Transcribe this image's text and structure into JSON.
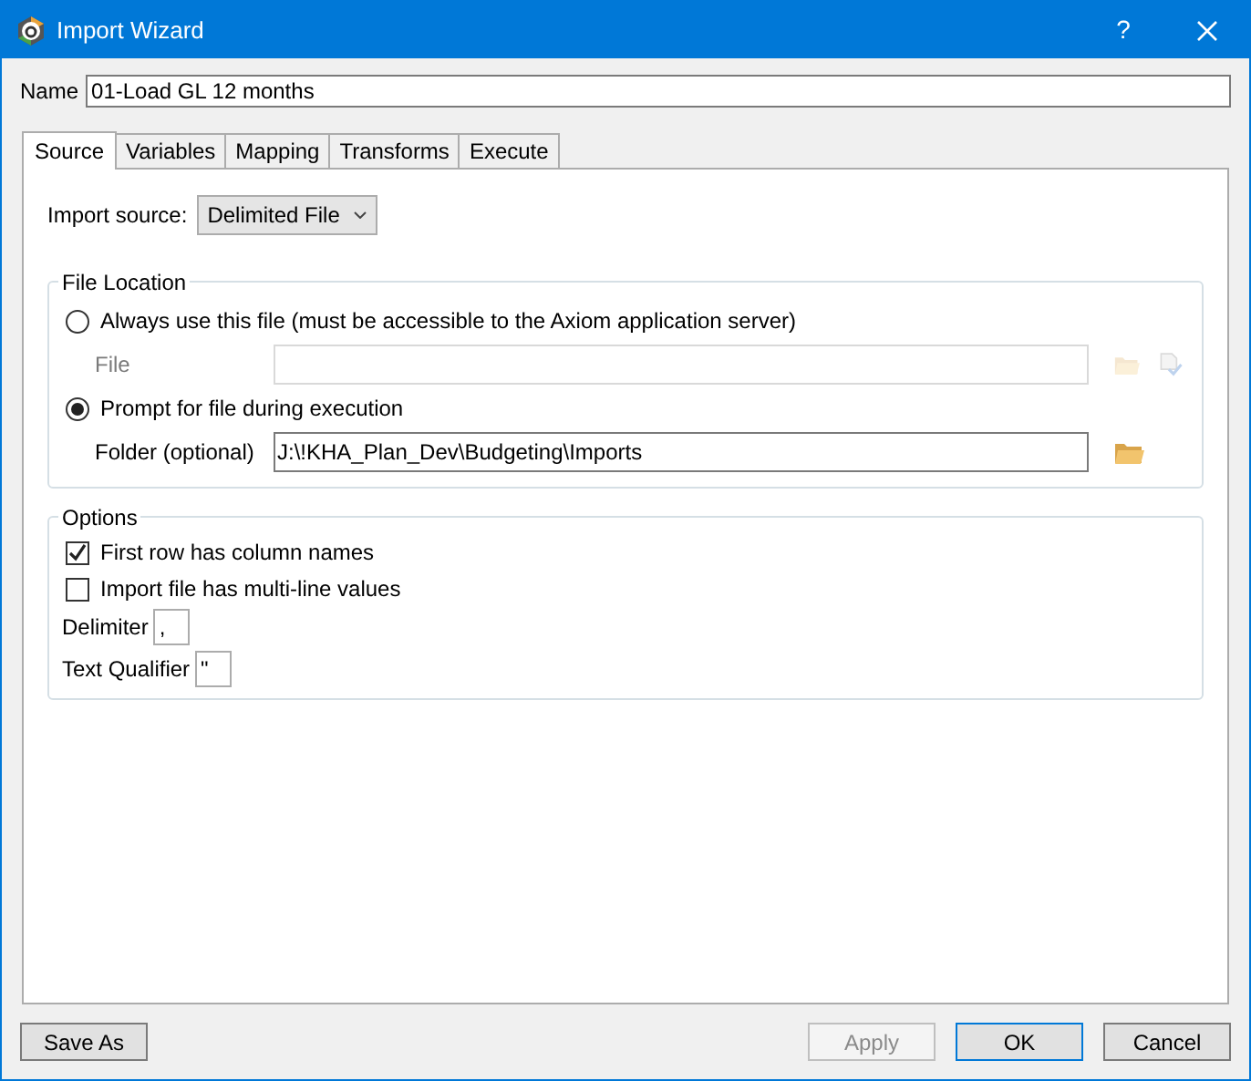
{
  "window": {
    "title": "Import Wizard",
    "help": "?"
  },
  "name_field": {
    "label": "Name",
    "value": "01-Load GL 12 months"
  },
  "tabs": [
    {
      "label": "Source",
      "selected": true
    },
    {
      "label": "Variables",
      "selected": false
    },
    {
      "label": "Mapping",
      "selected": false
    },
    {
      "label": "Transforms",
      "selected": false
    },
    {
      "label": "Execute",
      "selected": false
    }
  ],
  "import_source": {
    "label": "Import source:",
    "value": "Delimited File"
  },
  "file_location": {
    "title": "File Location",
    "options": [
      {
        "label": "Always use this file (must be accessible to the Axiom application server)",
        "selected": false,
        "field": {
          "kind": "file",
          "label": "File",
          "disabled": true
        }
      },
      {
        "label": "Prompt for file during execution",
        "selected": true,
        "field": {
          "kind": "folder",
          "label": "Folder (optional)",
          "value": "J:\\!KHA_Plan_Dev\\Budgeting\\Imports",
          "disabled": false
        }
      }
    ]
  },
  "options": {
    "title": "Options",
    "checkboxes": [
      {
        "label": "First row has column names",
        "checked": true
      },
      {
        "label": "Import file has multi-line values",
        "checked": false
      }
    ],
    "fields": [
      {
        "label": "Delimiter",
        "value": ","
      },
      {
        "label": "Text Qualifier",
        "value": "\""
      }
    ]
  },
  "left_buttons": [
    {
      "label": "Save As",
      "disabled": false,
      "default": false
    }
  ],
  "buttons": [
    {
      "label": "Apply",
      "disabled": true,
      "default": false
    },
    {
      "label": "OK",
      "disabled": false,
      "default": true
    },
    {
      "label": "Cancel",
      "disabled": false,
      "default": false
    }
  ]
}
